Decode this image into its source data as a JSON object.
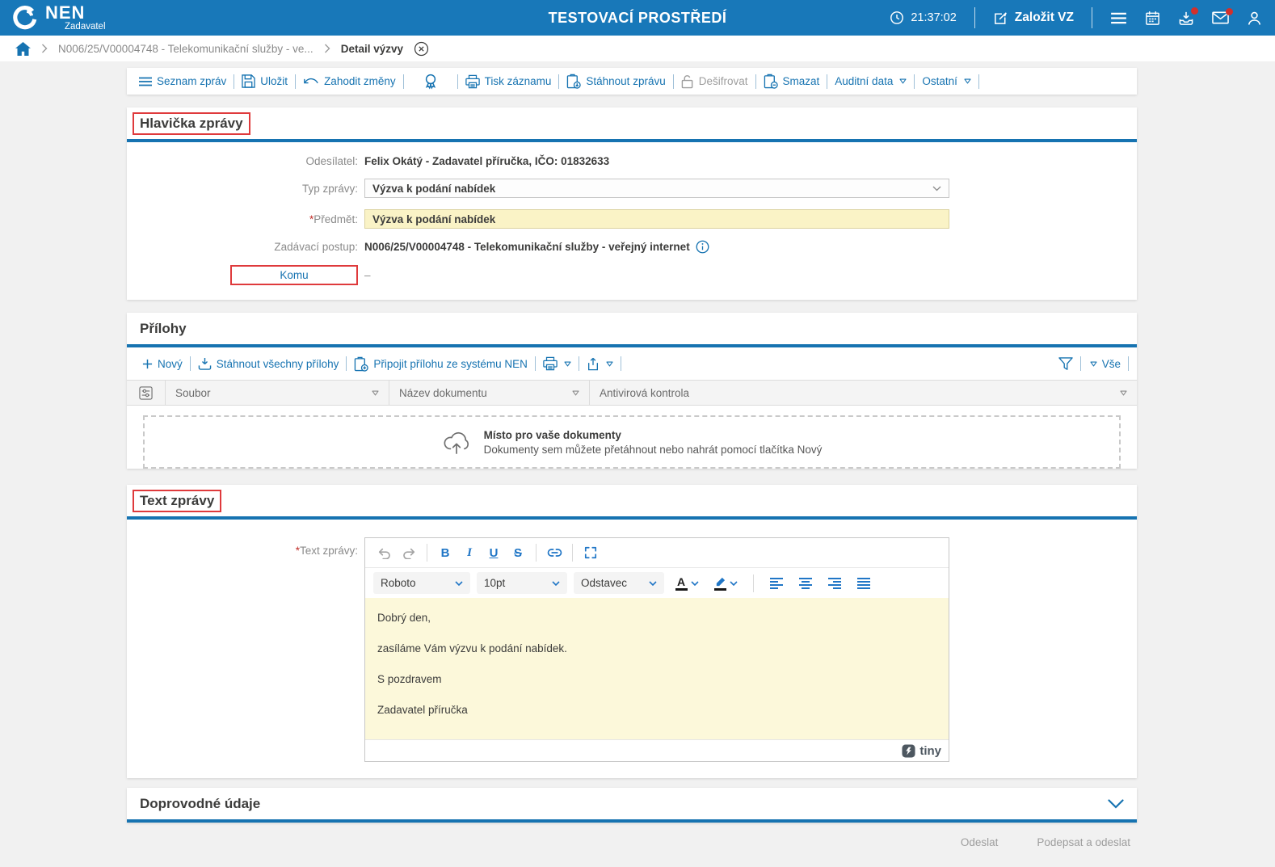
{
  "colors": {
    "header_bg": "#1878b9",
    "accent_blue": "#1673b1",
    "editor_icon_blue": "#2076c6",
    "annotation_red": "#df3a3c",
    "field_yellow": "#faf3c6",
    "editor_yellow": "#fcf8da",
    "badge_red": "#d2302c"
  },
  "header": {
    "app_name": "NEN",
    "app_subtitle": "Zadavatel",
    "environment": "TESTOVACÍ PROSTŘEDÍ",
    "time": "21:37:02",
    "create_button": "Založit VZ"
  },
  "breadcrumb": {
    "procedure": "N006/25/V00004748 - Telekomunikační služby - ve...",
    "current": "Detail výzvy"
  },
  "toolbar": {
    "list": "Seznam zpráv",
    "save": "Uložit",
    "discard": "Zahodit změny",
    "print": "Tisk záznamu",
    "download": "Stáhnout zprávu",
    "decrypt": "Dešifrovat",
    "delete": "Smazat",
    "audit": "Auditní data",
    "other": "Ostatní"
  },
  "message_header": {
    "title": "Hlavička zprávy",
    "required_marker": "*",
    "sender_label": "Odesílatel:",
    "sender_value": "Felix Okátý - Zadavatel příručka, IČO: 01832633",
    "type_label": "Typ zprávy:",
    "type_value": "Výzva k podání nabídek",
    "subject_label": "Předmět:",
    "subject_value": "Výzva k podání nabídek",
    "procedure_label": "Zadávací postup:",
    "procedure_value": "N006/25/V00004748 - Telekomunikační služby - veřejný internet",
    "recipient_label": "Komu",
    "recipient_value": "–"
  },
  "attachments": {
    "title": "Přílohy",
    "new": "Nový",
    "download_all": "Stáhnout všechny přílohy",
    "attach_from_nen": "Připojit přílohu ze systému NEN",
    "filter_all": "Vše",
    "columns": [
      "Soubor",
      "Název dokumentu",
      "Antivirová kontrola"
    ],
    "dropzone_title": "Místo pro vaše dokumenty",
    "dropzone_hint": "Dokumenty sem můžete přetáhnout nebo nahrát pomocí tlačítka Nový"
  },
  "message_body": {
    "title": "Text zprávy",
    "field_label": "Text zprávy:",
    "editor": {
      "font": "Roboto",
      "size": "10pt",
      "block": "Odstavec",
      "bold_glyph": "B",
      "italic_glyph": "I",
      "underline_glyph": "U",
      "strike_glyph": "S",
      "color_glyph": "A",
      "paragraphs": [
        "Dobrý den,",
        "zasíláme Vám výzvu k podání nabídek.",
        "S pozdravem",
        "Zadavatel příručka"
      ],
      "brand": "tiny"
    }
  },
  "additional": {
    "title": "Doprovodné údaje"
  },
  "actions": {
    "send": "Odeslat",
    "sign_and_send": "Podepsat a odeslat"
  }
}
